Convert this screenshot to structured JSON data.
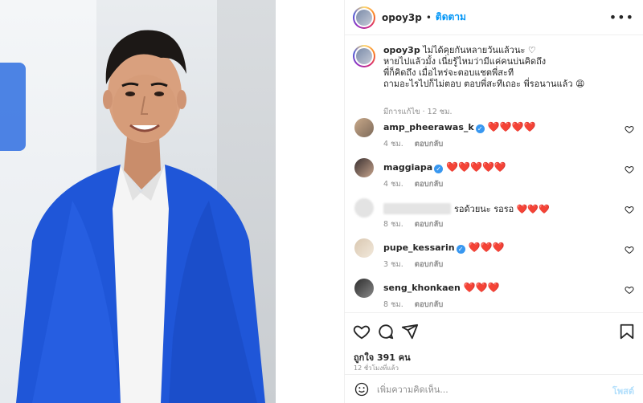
{
  "post": {
    "username": "opoy3p",
    "separator": "•",
    "follow_label": "ติดตาม",
    "more_icon": "more-horizontal-icon"
  },
  "caption": {
    "username": "opoy3p",
    "line1": "ไม่ได้คุยกันหลายวันแล้วนะ ♡",
    "line2": "หายไปแล้วมั้ง เนี่ยรู้ไหมว่ามีแค่คนบ่นคิดถึง",
    "line3": "พี่ก็คิดถึง เมื่อไหร่จะตอบแชตพี่สะที",
    "line4": "ถามอะไรไปก็ไม่ตอบ ตอบพี่สะทีเถอะ พี่รอนานแล้ว 😩",
    "meta": "มีการแก้ไข · 12 ชม."
  },
  "comments": [
    {
      "username": "amp_pheerawas_k",
      "verified": true,
      "text": "❤️❤️❤️❤️",
      "time": "4 ชม.",
      "reply_label": "ตอบกลับ"
    },
    {
      "username": "maggiapa",
      "verified": true,
      "text": "❤️❤️❤️❤️❤️",
      "time": "4 ชม.",
      "reply_label": "ตอบกลับ"
    },
    {
      "username": "",
      "verified": false,
      "text": "รอด้วยนะ รอรอ ❤️❤️❤️",
      "time": "8 ชม.",
      "reply_label": "ตอบกลับ"
    },
    {
      "username": "pupe_kessarin",
      "verified": true,
      "text": "❤️❤️❤️",
      "time": "3 ชม.",
      "reply_label": "ตอบกลับ"
    },
    {
      "username": "seng_khonkaen",
      "verified": false,
      "text": "❤️❤️❤️",
      "time": "8 ชม.",
      "reply_label": "ตอบกลับ"
    }
  ],
  "actions": {
    "likes": "ถูกใจ 391 คน",
    "time": "12 ชั่วโมงที่แล้ว"
  },
  "comment_box": {
    "placeholder": "เพิ่มความคิดเห็น...",
    "post_label": "โพสต์"
  },
  "colors": {
    "accent": "#0095f6",
    "heart": "#e0245e",
    "verified": "#3897f0",
    "muted": "#8e8e8e",
    "post_disabled": "#b2dffc"
  }
}
